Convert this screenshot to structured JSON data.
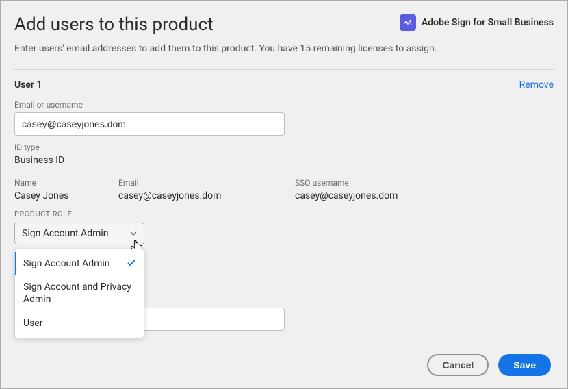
{
  "header": {
    "title": "Add users to this product",
    "product_name": "Adobe Sign for Small Business"
  },
  "subtitle": "Enter users' email addresses to add them to this product. You have 15 remaining licenses to assign.",
  "user1": {
    "label": "User 1",
    "remove": "Remove",
    "email_label": "Email or username",
    "email_value": "casey@caseyjones.dom",
    "id_type_label": "ID type",
    "id_type_value": "Business ID",
    "name_label": "Name",
    "name_value": "Casey Jones",
    "email_col_label": "Email",
    "email_col_value": "casey@caseyjones.dom",
    "sso_label": "SSO username",
    "sso_value": "casey@caseyjones.dom",
    "role_label": "PRODUCT ROLE",
    "role_selected": "Sign Account Admin",
    "role_options": {
      "opt1": "Sign Account Admin",
      "opt2": "Sign Account and Privacy Admin",
      "opt3": "User"
    }
  },
  "footer": {
    "cancel": "Cancel",
    "save": "Save"
  }
}
